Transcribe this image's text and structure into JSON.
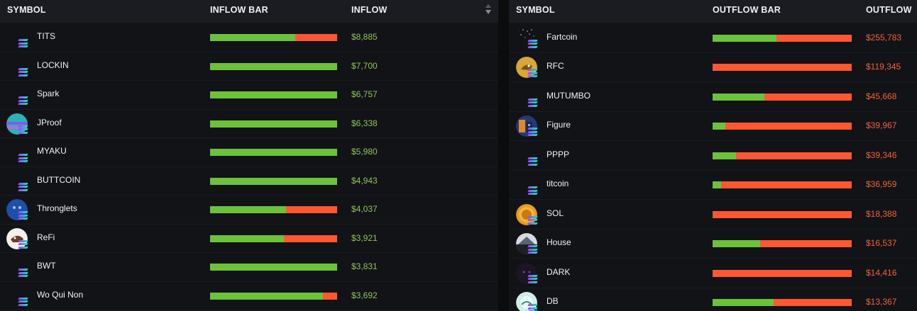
{
  "inflow_table": {
    "headers": {
      "symbol": "SYMBOL",
      "bar": "INFLOW BAR",
      "value": "INFLOW"
    },
    "rows": [
      {
        "symbol": "TITS",
        "value": "$8,885",
        "green_fraction": 0.67,
        "logo": "solana-icon"
      },
      {
        "symbol": "LOCKIN",
        "value": "$7,700",
        "green_fraction": 1.0,
        "logo": "solana-icon"
      },
      {
        "symbol": "Spark",
        "value": "$6,757",
        "green_fraction": 1.0,
        "logo": "solana-icon"
      },
      {
        "symbol": "JProof",
        "value": "$6,338",
        "green_fraction": 1.0,
        "logo": "jproof-logo-icon"
      },
      {
        "symbol": "MYAKU",
        "value": "$5,980",
        "green_fraction": 1.0,
        "logo": "solana-icon"
      },
      {
        "symbol": "BUTTCOIN",
        "value": "$4,943",
        "green_fraction": 1.0,
        "logo": "solana-icon"
      },
      {
        "symbol": "Thronglets",
        "value": "$4,037",
        "green_fraction": 0.6,
        "logo": "thronglets-logo-icon"
      },
      {
        "symbol": "ReFi",
        "value": "$3,921",
        "green_fraction": 0.58,
        "logo": "refi-logo-icon"
      },
      {
        "symbol": "BWT",
        "value": "$3,831",
        "green_fraction": 1.0,
        "logo": "solana-icon"
      },
      {
        "symbol": "Wo Qui Non",
        "value": "$3,692",
        "green_fraction": 0.89,
        "logo": "solana-icon"
      }
    ]
  },
  "outflow_table": {
    "headers": {
      "symbol": "SYMBOL",
      "bar": "OUTFLOW BAR",
      "value": "OUTFLOW"
    },
    "rows": [
      {
        "symbol": "Fartcoin",
        "value": "$255,783",
        "green_fraction": 0.46,
        "logo": "fartcoin-logo-icon"
      },
      {
        "symbol": "RFC",
        "value": "$119,345",
        "green_fraction": 0.0,
        "logo": "rfc-logo-icon"
      },
      {
        "symbol": "MUTUMBO",
        "value": "$45,668",
        "green_fraction": 0.37,
        "logo": "solana-icon"
      },
      {
        "symbol": "Figure",
        "value": "$39,967",
        "green_fraction": 0.09,
        "logo": "figure-logo-icon"
      },
      {
        "symbol": "PPPP",
        "value": "$39,346",
        "green_fraction": 0.17,
        "logo": "solana-icon"
      },
      {
        "symbol": "titcoin",
        "value": "$36,959",
        "green_fraction": 0.06,
        "logo": "solana-icon"
      },
      {
        "symbol": "SOL",
        "value": "$18,388",
        "green_fraction": 0.0,
        "logo": "sol-coin-logo-icon"
      },
      {
        "symbol": "House",
        "value": "$16,537",
        "green_fraction": 0.34,
        "logo": "house-logo-icon"
      },
      {
        "symbol": "DARK",
        "value": "$14,416",
        "green_fraction": 0.0,
        "logo": "dark-logo-icon"
      },
      {
        "symbol": "DB",
        "value": "$13,367",
        "green_fraction": 0.44,
        "logo": "db-logo-icon"
      }
    ]
  },
  "colors": {
    "inflow_bar": "#6cc23a",
    "outflow_bar": "#ff5733",
    "inflow_text": "#8fc45a",
    "outflow_text": "#f0623a"
  }
}
